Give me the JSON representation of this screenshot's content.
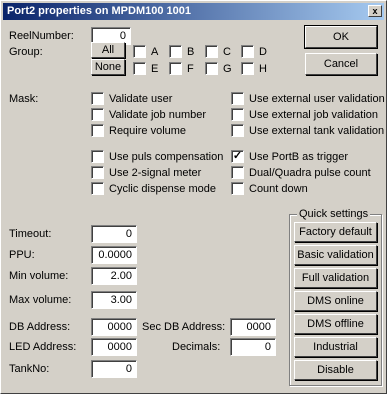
{
  "window": {
    "title": "Port2 properties on MPDM100 1001",
    "close_label": "x"
  },
  "reel": {
    "label": "ReelNumber:",
    "value": "0"
  },
  "group": {
    "label": "Group:",
    "all_label": "All",
    "none_label": "None",
    "letters_row1": [
      "A",
      "B",
      "C",
      "D"
    ],
    "letters_row2": [
      "E",
      "F",
      "G",
      "H"
    ]
  },
  "buttons": {
    "ok": "OK",
    "cancel": "Cancel"
  },
  "mask": {
    "label": "Mask:",
    "left": [
      "Validate user",
      "Validate job number",
      "Require volume"
    ],
    "right": [
      "Use external user validation",
      "Use external job validation",
      "Use external tank validation"
    ]
  },
  "options": {
    "left": [
      "Use puls compensation",
      "Use 2-signal meter",
      "Cyclic dispense mode"
    ],
    "right": [
      "Use PortB as trigger",
      "Dual/Quadra pulse count",
      "Count down"
    ],
    "right_checked": [
      true,
      false,
      false
    ]
  },
  "fields": {
    "timeout": {
      "label": "Timeout:",
      "value": "0"
    },
    "ppu": {
      "label": "PPU:",
      "value": "0.0000"
    },
    "min_volume": {
      "label": "Min volume:",
      "value": "2.00"
    },
    "max_volume": {
      "label": "Max volume:",
      "value": "3.00"
    },
    "db_address": {
      "label": "DB Address:",
      "value": "0000"
    },
    "sec_db_address": {
      "label": "Sec DB Address:",
      "value": "0000"
    },
    "led_address": {
      "label": "LED Address:",
      "value": "0000"
    },
    "decimals": {
      "label": "Decimals:",
      "value": "0"
    },
    "tank_no": {
      "label": "TankNo:",
      "value": "0"
    }
  },
  "quick_settings": {
    "title": "Quick settings",
    "buttons": [
      "Factory default",
      "Basic validation",
      "Full validation",
      "DMS online",
      "DMS offline",
      "Industrial",
      "Disable"
    ]
  }
}
